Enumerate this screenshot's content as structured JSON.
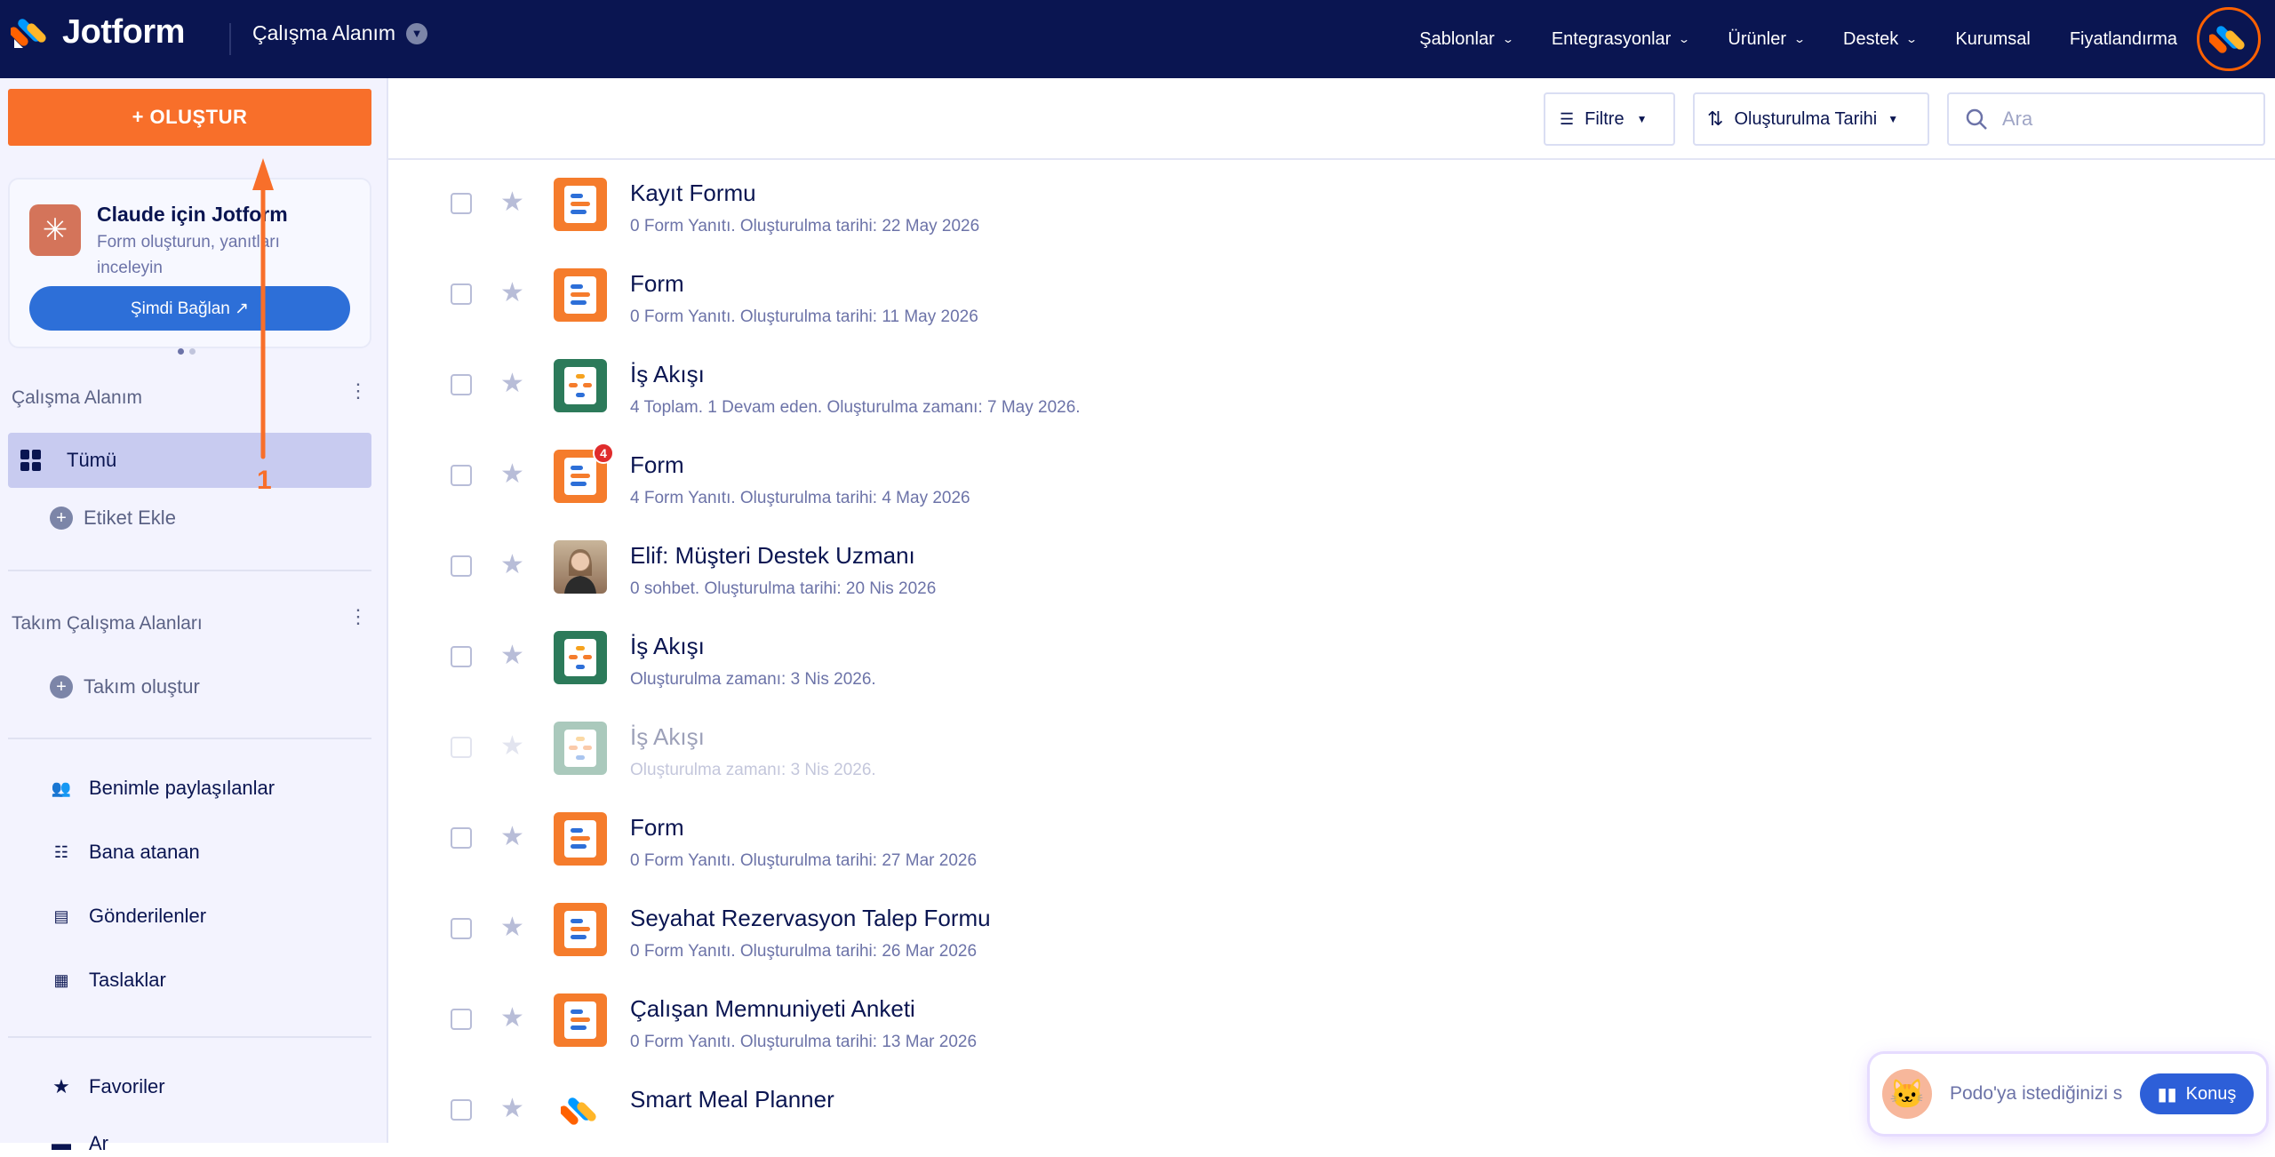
{
  "brand": {
    "name": "Jotform"
  },
  "header": {
    "workspace": "Çalışma Alanım",
    "nav": [
      {
        "label": "Şablonlar",
        "dropdown": true
      },
      {
        "label": "Entegrasyonlar",
        "dropdown": true
      },
      {
        "label": "Ürünler",
        "dropdown": true
      },
      {
        "label": "Destek",
        "dropdown": true
      },
      {
        "label": "Kurumsal",
        "dropdown": false
      },
      {
        "label": "Fiyatlandırma",
        "dropdown": false
      }
    ]
  },
  "sidebar": {
    "create_label": "+ OLUŞTUR",
    "promo": {
      "title": "Claude için Jotform",
      "subtitle": "Form oluşturun, yanıtları inceleyin",
      "button": "Şimdi Bağlan ↗"
    },
    "workspace_heading": "Çalışma Alanım",
    "all_label": "Tümü",
    "add_tag": "Etiket Ekle",
    "team_heading": "Takım Çalışma Alanları",
    "create_team": "Takım oluştur",
    "links": [
      {
        "label": "Benimle paylaşılanlar",
        "icon": "users-icon"
      },
      {
        "label": "Bana atanan",
        "icon": "checklist-icon"
      },
      {
        "label": "Gönderilenler",
        "icon": "message-icon"
      },
      {
        "label": "Taslaklar",
        "icon": "draft-icon"
      }
    ],
    "favorites": "Favoriler",
    "archive_partial": "Ar"
  },
  "toolbar": {
    "filter": "Filtre",
    "sort": "Oluşturulma Tarihi",
    "search_placeholder": "Ara"
  },
  "items": [
    {
      "title": "Kayıt Formu",
      "sub": "0 Form Yanıtı. Oluşturulma tarihi: 22 May 2026",
      "kind": "form"
    },
    {
      "title": "Form",
      "sub": "0 Form Yanıtı. Oluşturulma tarihi: 11 May 2026",
      "kind": "form"
    },
    {
      "title": "İş Akışı",
      "sub": "4 Toplam. 1 Devam eden. Oluşturulma zamanı: 7 May 2026.",
      "kind": "workflow"
    },
    {
      "title": "Form",
      "sub": "4 Form Yanıtı. Oluşturulma tarihi: 4 May 2026",
      "kind": "form",
      "badge": "4"
    },
    {
      "title": "Elif: Müşteri Destek Uzmanı",
      "sub": "0 sohbet. Oluşturulma tarihi: 20 Nis 2026",
      "kind": "agent"
    },
    {
      "title": "İş Akışı",
      "sub": "Oluşturulma zamanı: 3 Nis 2026.",
      "kind": "workflow"
    },
    {
      "title": "İş Akışı",
      "sub": "Oluşturulma zamanı: 3 Nis 2026.",
      "kind": "workflow",
      "faded": true
    },
    {
      "title": "Form",
      "sub": "0 Form Yanıtı. Oluşturulma tarihi: 27 Mar 2026",
      "kind": "form"
    },
    {
      "title": "Seyahat Rezervasyon Talep Formu",
      "sub": "0 Form Yanıtı. Oluşturulma tarihi: 26 Mar 2026",
      "kind": "form"
    },
    {
      "title": "Çalışan Memnuniyeti Anketi",
      "sub": "0 Form Yanıtı. Oluşturulma tarihi: 13 Mar 2026",
      "kind": "form"
    },
    {
      "title": "Smart Meal Planner",
      "sub": "",
      "kind": "app"
    }
  ],
  "podo": {
    "placeholder": "Podo'ya istediğinizi s",
    "button": "Konuş"
  },
  "annotation": {
    "label": "1"
  },
  "colors": {
    "navy": "#0a1551",
    "orange": "#f86f2a",
    "blue": "#2d6fd8",
    "green": "#2c7a5a"
  }
}
